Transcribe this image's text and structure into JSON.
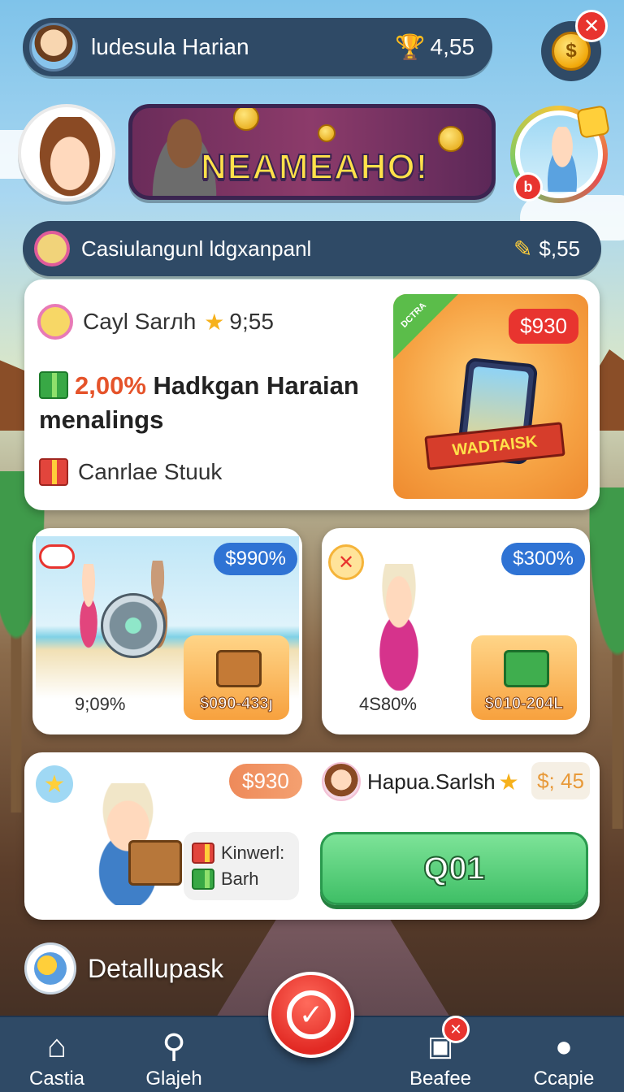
{
  "header": {
    "title": "ludesula Harian",
    "currency_amount": "4,55",
    "coin_symbol": "$",
    "close_symbol": "✕"
  },
  "hero": {
    "banner_text": "NEAMEAHO!",
    "friend_badge_symbol": "b"
  },
  "subbar": {
    "title": "Casiulangunl ldgxanpanl",
    "amount": "$,55"
  },
  "main_card": {
    "player_name": "Cayl Sarлh",
    "player_score": "9;55",
    "headline_pct": "2,00%",
    "headline_rest": "Hadkgan Haraian menalings",
    "product_label": "Canrlae Stuuk",
    "promo_tag": "DCTRA",
    "promo_price": "$930",
    "promo_ribbon": "WADTAISK"
  },
  "offer_a": {
    "discount": "$990%",
    "stat": "9;09%",
    "box_price": "$090-433ȷ"
  },
  "offer_b": {
    "close_symbol": "✕",
    "discount": "$300%",
    "stat": "4S80%",
    "box_price": "$010-204L"
  },
  "offer_c": {
    "star_symbol": "★",
    "price": "$930",
    "list": [
      {
        "label": "Kinwerl:"
      },
      {
        "label": "Barh"
      }
    ],
    "player_name": "Hapua.Sarlsh",
    "player_price": "$; 45",
    "go_button": "Q01"
  },
  "details": {
    "label": "Detallupask"
  },
  "nav": {
    "items": [
      {
        "label": "Castia",
        "icon": "home-icon"
      },
      {
        "label": "Glajeh",
        "icon": "search-icon"
      },
      {
        "label": "Beafee",
        "icon": "gallery-icon"
      },
      {
        "label": "Ccapie",
        "icon": "user-icon"
      }
    ],
    "center_symbol": "✓",
    "badge_symbol": "✕"
  },
  "colors": {
    "panel": "#2f4a66",
    "accent_red": "#e8342f",
    "accent_green": "#3fbf66",
    "accent_gold": "#ffcf3a",
    "pill_blue": "#2f73d4"
  }
}
